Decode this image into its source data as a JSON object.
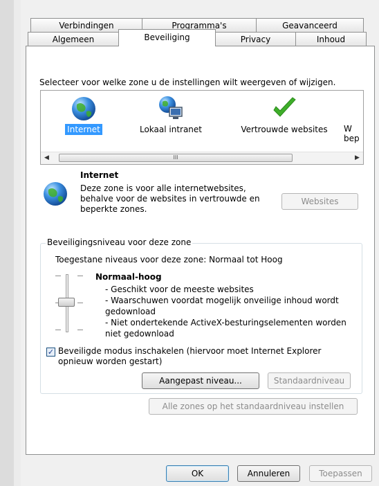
{
  "tabs": {
    "row_back": [
      "Verbindingen",
      "Programma's",
      "Geavanceerd"
    ],
    "row_front": [
      "Algemeen",
      "Beveiliging",
      "Privacy",
      "Inhoud"
    ]
  },
  "zone_prompt": "Selecteer voor welke zone u de instellingen wilt weergeven of wijzigen.",
  "zones": [
    {
      "label": "Internet",
      "icon": "globe-icon",
      "selected": true
    },
    {
      "label": "Lokaal intranet",
      "icon": "intranet-icon",
      "selected": false
    },
    {
      "label": "Vertrouwde websites",
      "icon": "checkmark-icon",
      "selected": false
    },
    {
      "label": "W\nbep",
      "icon": "restricted-icon",
      "selected": false
    }
  ],
  "scrollbar_grip": "III",
  "zone_info": {
    "title": "Internet",
    "description_lines": [
      "Deze zone is voor alle internetwebsites,",
      "behalve voor de websites in vertrouwde en",
      "beperkte zones."
    ],
    "websites_button": "Websites"
  },
  "security_group": {
    "title": "Beveiligingsniveau voor deze zone",
    "allowed_levels": "Toegestane niveaus voor deze zone: Normaal tot Hoog",
    "level_name": "Normaal-hoog",
    "level_bullets": [
      "- Geschikt voor de meeste websites",
      "- Waarschuwen voordat mogelijk onveilige inhoud wordt",
      "gedownload",
      "- Niet ondertekende ActiveX-besturingselementen worden",
      "niet gedownload"
    ],
    "protected_mode_label_lines": [
      "Beveiligde modus inschakelen (hiervoor moet Internet Explorer",
      "opnieuw worden gestart)"
    ],
    "protected_mode_checked": true,
    "custom_level_button": "Aangepast niveau...",
    "default_level_button": "Standaardniveau"
  },
  "reset_all_button": "Alle zones op het standaardniveau instellen",
  "footer": {
    "ok": "OK",
    "cancel": "Annuleren",
    "apply": "Toepassen"
  },
  "colors": {
    "selection": "#3399ff",
    "check_green": "#3fae2a",
    "globe_blue": "#2a78c8"
  }
}
